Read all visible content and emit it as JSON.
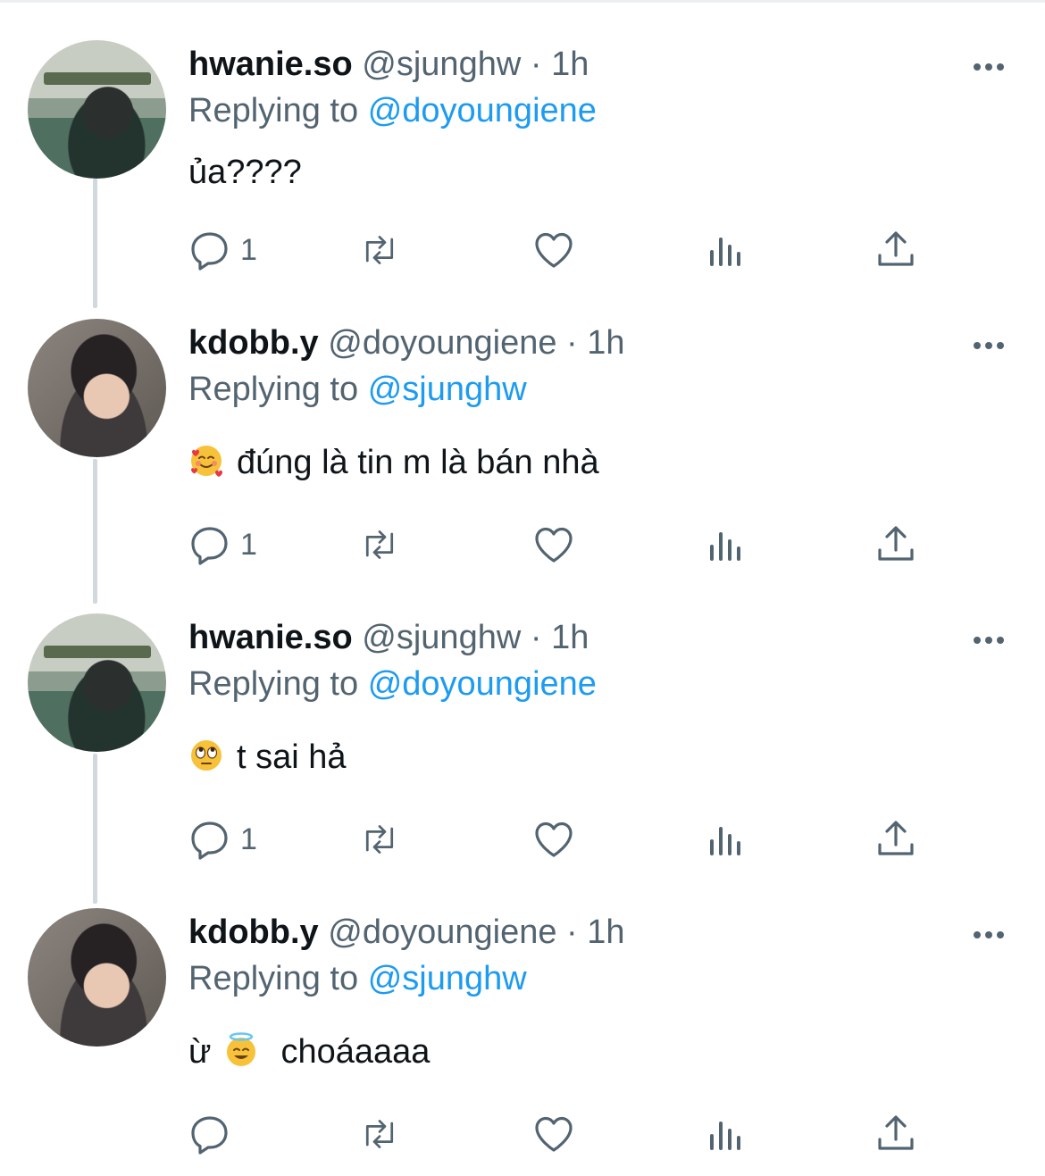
{
  "tweets": [
    {
      "name": "hwanie.so",
      "handle": "@sjunghw",
      "time": "1h",
      "reply_prefix": "Replying to",
      "reply_to": "@doyoungiene",
      "emoji": "",
      "text": "ủa????",
      "reply_count": "1",
      "avatar": "avatar-hwanie"
    },
    {
      "name": "kdobb.y",
      "handle": "@doyoungiene",
      "time": "1h",
      "reply_prefix": "Replying to",
      "reply_to": "@sjunghw",
      "emoji": "smiling-face-with-hearts",
      "text": "đúng là tin m là bán nhà",
      "reply_count": "1",
      "avatar": "avatar-kdobby"
    },
    {
      "name": "hwanie.so",
      "handle": "@sjunghw",
      "time": "1h",
      "reply_prefix": "Replying to",
      "reply_to": "@doyoungiene",
      "emoji": "rolling-eyes",
      "text": "t sai hả",
      "reply_count": "1",
      "avatar": "avatar-hwanie"
    },
    {
      "name": "kdobb.y",
      "handle": "@doyoungiene",
      "time": "1h",
      "reply_prefix": "Replying to",
      "reply_to": "@sjunghw",
      "emoji": "smiling-face-with-halo",
      "text_before_emoji": "ừ",
      "text": "choáaaaa",
      "reply_count": "",
      "avatar": "avatar-kdobby"
    }
  ],
  "icons": {
    "reply": "reply-icon",
    "retweet": "retweet-icon",
    "like": "heart-icon",
    "views": "views-icon",
    "share": "share-icon",
    "more": "more-icon"
  },
  "colors": {
    "link": "#1d9bf0",
    "secondary": "#536471",
    "primary_text": "#0f1419",
    "thread_line": "#cfd9de"
  }
}
